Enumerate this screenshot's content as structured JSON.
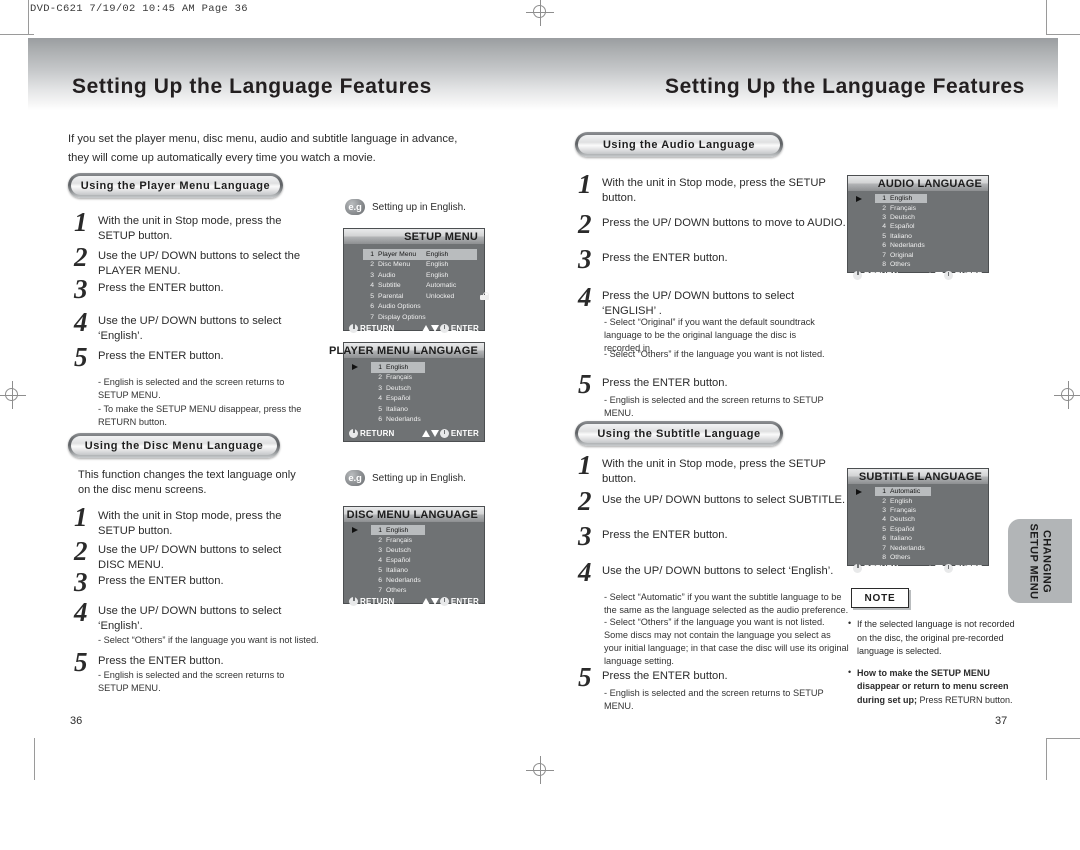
{
  "slug": "DVD-C621  7/19/02 10:45 AM  Page 36",
  "header": {
    "title_left": "Setting Up the Language Features",
    "title_right": "Setting Up the Language Features"
  },
  "intro": "If you set the player menu, disc menu, audio and subtitle language in advance, they will come up automatically every time you watch a movie.",
  "sections": {
    "player_menu": {
      "heading": "Using the Player Menu Language",
      "steps": [
        {
          "num": "1",
          "text": "With the unit in Stop mode, press the SETUP button."
        },
        {
          "num": "2",
          "text": "Use the UP/ DOWN buttons to select the PLAYER MENU."
        },
        {
          "num": "3",
          "text": "Press the ENTER button."
        },
        {
          "num": "4",
          "text": "Use the UP/ DOWN buttons to select ‘English’."
        },
        {
          "num": "5",
          "text": "Press the ENTER button."
        }
      ],
      "notes": [
        "- English is selected and the screen returns to SETUP MENU.",
        "- To make the SETUP MENU disappear, press the RETURN button."
      ]
    },
    "disc_menu": {
      "heading": "Using the Disc Menu Language",
      "lead": "This function changes the text language only on the disc menu screens.",
      "steps": [
        {
          "num": "1",
          "text": "With the unit in Stop mode, press the SETUP button."
        },
        {
          "num": "2",
          "text": "Use the UP/ DOWN buttons to select DISC MENU."
        },
        {
          "num": "3",
          "text": "Press the ENTER button."
        },
        {
          "num": "4",
          "text": "Use the UP/ DOWN buttons to select ‘English’."
        },
        {
          "num": "5",
          "text": "Press the ENTER button."
        }
      ],
      "note_after_4": "- Select “Others” if the language you want is not listed.",
      "note_after_5": "- English is selected and the screen returns to SETUP MENU."
    },
    "audio": {
      "heading": "Using the Audio Language",
      "steps": [
        {
          "num": "1",
          "text": "With the unit in Stop mode, press the SETUP button."
        },
        {
          "num": "2",
          "text": "Press the UP/ DOWN buttons to move to AUDIO."
        },
        {
          "num": "3",
          "text": "Press the ENTER button."
        },
        {
          "num": "4",
          "text": "Press the UP/ DOWN buttons to select ‘ENGLISH’ ."
        },
        {
          "num": "5",
          "text": "Press the ENTER button."
        }
      ],
      "note_after_4_a": "- Select “Original” if you want the default soundtrack language to be the original language the disc is recorded in.",
      "note_after_4_b": "- Select “Others” if the language you want is not listed.",
      "note_after_5": "- English is selected and the screen returns to SETUP MENU."
    },
    "subtitle": {
      "heading": "Using the Subtitle Language",
      "steps": [
        {
          "num": "1",
          "text": "With the unit in Stop mode, press the SETUP button."
        },
        {
          "num": "2",
          "text": "Use the UP/ DOWN buttons to select SUBTITLE."
        },
        {
          "num": "3",
          "text": "Press the ENTER button."
        },
        {
          "num": "4",
          "text": "Use the UP/ DOWN buttons to select ‘English’."
        },
        {
          "num": "5",
          "text": "Press the ENTER button."
        }
      ],
      "note_after_4_a": "- Select “Automatic” if you want the subtitle language to be the same as the language selected as the audio preference.",
      "note_after_4_b": "- Select “Others” if the language you want is not listed. Some discs may not contain the language you  select as your initial language; in that case the disc will use its original language setting.",
      "note_after_5": "- English is selected and the screen returns to SETUP MENU."
    }
  },
  "eg": {
    "badge": "e.g",
    "label_1": "Setting up in English.",
    "label_2": "Setting up in English."
  },
  "osd": {
    "setup_menu": {
      "title": "SETUP MENU",
      "rows": [
        {
          "n": "1",
          "label": "Player Menu",
          "value": "English",
          "selected": true
        },
        {
          "n": "2",
          "label": "Disc Menu",
          "value": "English",
          "selected": false
        },
        {
          "n": "3",
          "label": "Audio",
          "value": "English",
          "selected": false
        },
        {
          "n": "4",
          "label": "Subtitle",
          "value": "Automatic",
          "selected": false
        },
        {
          "n": "5",
          "label": "Parental",
          "value": "Unlocked",
          "selected": false,
          "lock": true
        },
        {
          "n": "6",
          "label": "Audio Options",
          "value": "",
          "selected": false
        },
        {
          "n": "7",
          "label": "Display Options",
          "value": "",
          "selected": false
        }
      ],
      "return_label": "RETURN",
      "enter_label": "ENTER"
    },
    "player_menu_language": {
      "title": "PLAYER MENU LANGUAGE",
      "rows": [
        {
          "n": "1",
          "label": "English",
          "selected": true,
          "caret": true
        },
        {
          "n": "2",
          "label": "Français",
          "selected": false
        },
        {
          "n": "3",
          "label": "Deutsch",
          "selected": false
        },
        {
          "n": "4",
          "label": "Español",
          "selected": false
        },
        {
          "n": "5",
          "label": "Italiano",
          "selected": false
        },
        {
          "n": "6",
          "label": "Nederlands",
          "selected": false
        }
      ],
      "return_label": "RETURN",
      "enter_label": "ENTER"
    },
    "disc_menu_language": {
      "title": "DISC MENU LANGUAGE",
      "rows": [
        {
          "n": "1",
          "label": "English",
          "selected": true,
          "caret": true
        },
        {
          "n": "2",
          "label": "Français",
          "selected": false
        },
        {
          "n": "3",
          "label": "Deutsch",
          "selected": false
        },
        {
          "n": "4",
          "label": "Español",
          "selected": false
        },
        {
          "n": "5",
          "label": "Italiano",
          "selected": false
        },
        {
          "n": "6",
          "label": "Nederlands",
          "selected": false
        },
        {
          "n": "7",
          "label": "Others",
          "selected": false
        }
      ],
      "return_label": "RETURN",
      "enter_label": "ENTER"
    },
    "audio_language": {
      "title": "AUDIO LANGUAGE",
      "rows": [
        {
          "n": "1",
          "label": "English",
          "selected": true,
          "caret": true
        },
        {
          "n": "2",
          "label": "Français",
          "selected": false
        },
        {
          "n": "3",
          "label": "Deutsch",
          "selected": false
        },
        {
          "n": "4",
          "label": "Español",
          "selected": false
        },
        {
          "n": "5",
          "label": "Italiano",
          "selected": false
        },
        {
          "n": "6",
          "label": "Nederlands",
          "selected": false
        },
        {
          "n": "7",
          "label": "Original",
          "selected": false
        },
        {
          "n": "8",
          "label": "Others",
          "selected": false
        }
      ],
      "return_label": "RETURN",
      "enter_label": "ENTER"
    },
    "subtitle_language": {
      "title": "SUBTITLE LANGUAGE",
      "rows": [
        {
          "n": "1",
          "label": "Automatic",
          "selected": true,
          "caret": true
        },
        {
          "n": "2",
          "label": "English",
          "selected": false
        },
        {
          "n": "3",
          "label": "Français",
          "selected": false
        },
        {
          "n": "4",
          "label": "Deutsch",
          "selected": false
        },
        {
          "n": "5",
          "label": "Español",
          "selected": false
        },
        {
          "n": "6",
          "label": "Italiano",
          "selected": false
        },
        {
          "n": "7",
          "label": "Nederlands",
          "selected": false
        },
        {
          "n": "8",
          "label": "Others",
          "selected": false
        }
      ],
      "return_label": "RETURN",
      "enter_label": "ENTER"
    }
  },
  "note": {
    "title": "NOTE",
    "items": [
      "If the selected language is not recorded on the disc, the original pre-recorded language is selected.",
      "How to make the SETUP MENU disappear or return to menu screen during set up; Press RETURN button."
    ]
  },
  "side_tab": "CHANGING\nSETUP MENU",
  "folio": {
    "left": "36",
    "right": "37"
  }
}
